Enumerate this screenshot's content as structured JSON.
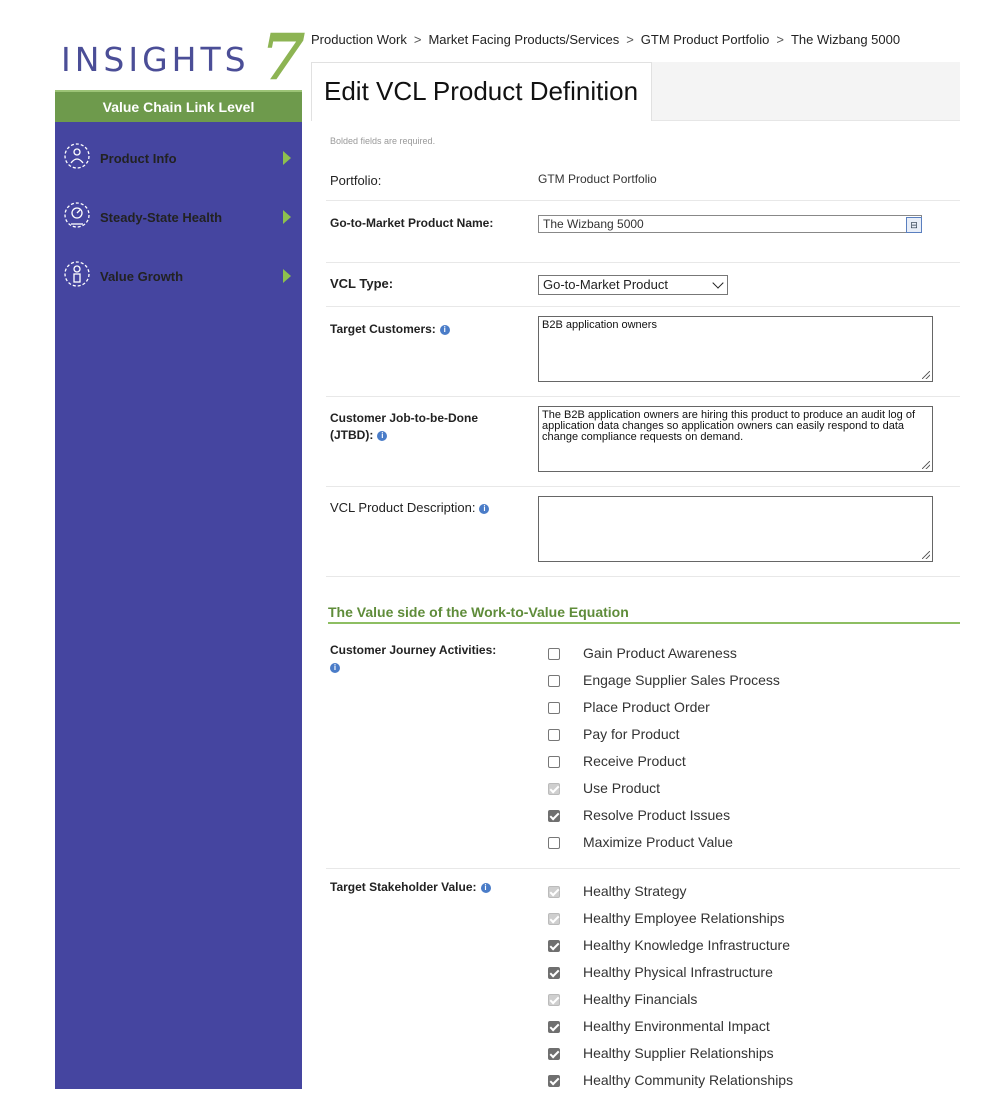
{
  "sidebar": {
    "logo_text": "INSIGHTS",
    "logo_numeral": "7",
    "level_label": "Value Chain Link Level",
    "items": [
      {
        "label": "Product Info",
        "icon": "gear-person-icon"
      },
      {
        "label": "Steady-State Health",
        "icon": "gauge-person-icon"
      },
      {
        "label": "Value Growth",
        "icon": "growth-person-icon"
      }
    ]
  },
  "breadcrumb": [
    "Production Work",
    "Market Facing Products/Services",
    "GTM Product Portfolio",
    "The Wizbang 5000"
  ],
  "breadcrumb_separator": ">",
  "page_title": "Edit VCL Product Definition",
  "form": {
    "required_note": "Bolded fields are required.",
    "portfolio_label": "Portfolio:",
    "portfolio_value": "GTM Product Portfolio",
    "gtm_name_label": "Go-to-Market Product Name:",
    "gtm_name_value": "The Wizbang 5000",
    "vcl_type_label": "VCL Type:",
    "vcl_type_value": "Go-to-Market Product",
    "target_customers_label": "Target Customers:",
    "target_customers_value": "B2B application owners",
    "jtbd_label": "Customer Job-to-be-Done (JTBD):",
    "jtbd_value": "The B2B application owners are hiring this product to produce an audit log of application data changes so application owners can easily respond to data change compliance requests on demand.",
    "description_label": "VCL Product Description:",
    "description_value": "",
    "value_section_title": "The Value side of the Work-to-Value Equation",
    "journey_label": "Customer Journey Activities:",
    "journey_activities": [
      {
        "label": "Gain Product Awareness",
        "state": "unchecked"
      },
      {
        "label": "Engage Supplier Sales Process",
        "state": "unchecked"
      },
      {
        "label": "Place Product Order",
        "state": "unchecked"
      },
      {
        "label": "Pay for Product",
        "state": "unchecked"
      },
      {
        "label": "Receive Product",
        "state": "unchecked"
      },
      {
        "label": "Use Product",
        "state": "disabled-checked"
      },
      {
        "label": "Resolve Product Issues",
        "state": "checked"
      },
      {
        "label": "Maximize Product Value",
        "state": "unchecked"
      }
    ],
    "stakeholder_label": "Target Stakeholder Value:",
    "stakeholder_values": [
      {
        "label": "Healthy Strategy",
        "state": "disabled-checked"
      },
      {
        "label": "Healthy Employee Relationships",
        "state": "disabled-checked"
      },
      {
        "label": "Healthy Knowledge Infrastructure",
        "state": "checked"
      },
      {
        "label": "Healthy Physical Infrastructure",
        "state": "checked"
      },
      {
        "label": "Healthy Financials",
        "state": "disabled-checked"
      },
      {
        "label": "Healthy Environmental Impact",
        "state": "checked"
      },
      {
        "label": "Healthy Supplier Relationships",
        "state": "checked"
      },
      {
        "label": "Healthy Community Relationships",
        "state": "checked"
      }
    ]
  },
  "colors": {
    "sidebar_bg": "#4545a0",
    "level_bar_bg": "#6e9a4c",
    "accent_green": "#8dbe62",
    "logo_blue": "#4b4e97"
  }
}
